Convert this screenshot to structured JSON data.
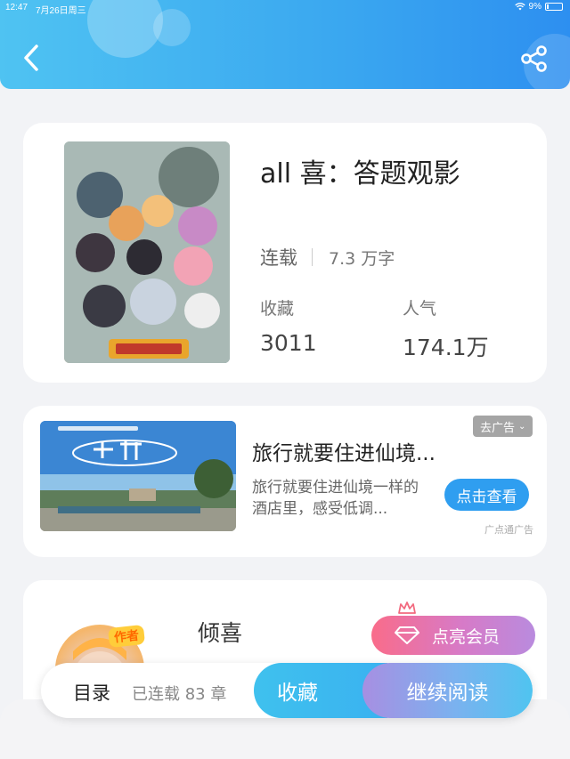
{
  "status_bar": {
    "time": "12:47",
    "date": "7月26日周三",
    "battery": "9%"
  },
  "header": {
    "back_icon": "chevron-left-icon",
    "share_icon": "share-icon",
    "gradient_start": "#4fc3f2",
    "gradient_end": "#2d8ff0"
  },
  "book": {
    "title": "all 喜：答题观影",
    "status": "连载",
    "word_count": "7.3 万字",
    "favorites_label": "收藏",
    "favorites_value": "3011",
    "popularity_label": "人气",
    "popularity_value": "174.1万"
  },
  "ad": {
    "title": "旅行就要住进仙境...",
    "description": "旅行就要住进仙境一样的酒店里，感受低调...",
    "close_label": "去广告",
    "cta_label": "点击查看",
    "source": "广点通广告"
  },
  "author": {
    "badge": "作者",
    "name": "倾喜",
    "vip_label": "点亮会员"
  },
  "bottom_bar": {
    "toc_label": "目录",
    "chapter_count": "已连载 83 章",
    "favorite_label": "收藏",
    "read_label": "继续阅读"
  }
}
